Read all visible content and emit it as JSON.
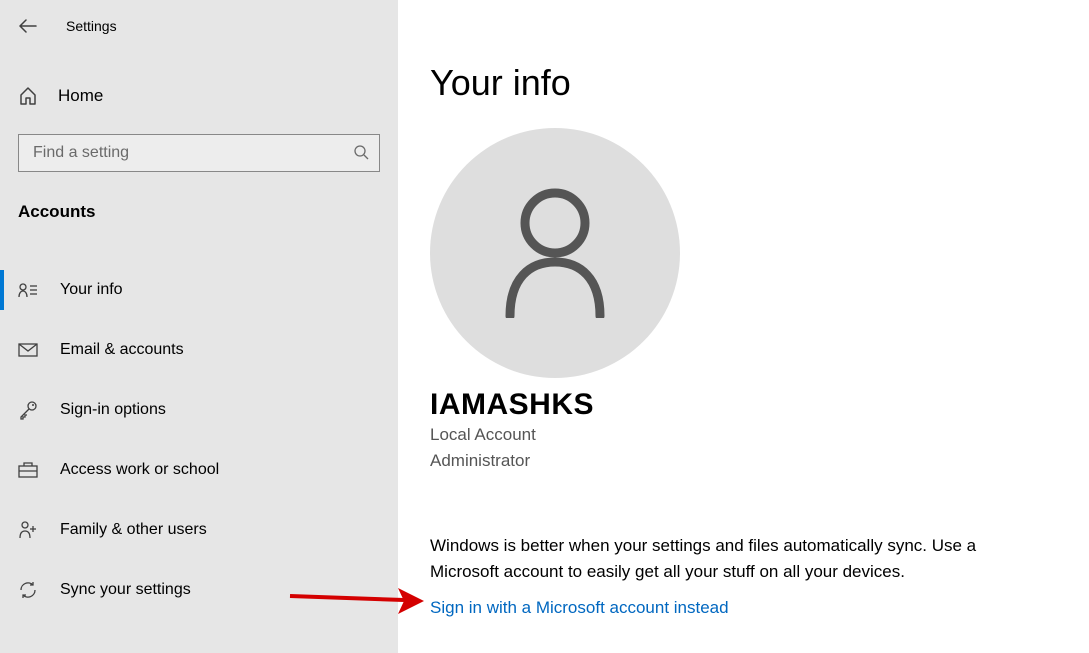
{
  "header": {
    "title": "Settings"
  },
  "sidebar": {
    "home_label": "Home",
    "search_placeholder": "Find a setting",
    "section_title": "Accounts",
    "items": [
      {
        "label": "Your info",
        "icon": "your-info-icon",
        "active": true
      },
      {
        "label": "Email & accounts",
        "icon": "email-icon",
        "active": false
      },
      {
        "label": "Sign-in options",
        "icon": "key-icon",
        "active": false
      },
      {
        "label": "Access work or school",
        "icon": "briefcase-icon",
        "active": false
      },
      {
        "label": "Family & other users",
        "icon": "family-icon",
        "active": false
      },
      {
        "label": "Sync your settings",
        "icon": "sync-icon",
        "active": false
      }
    ]
  },
  "main": {
    "title": "Your info",
    "user_name": "IAMASHKS",
    "account_type": "Local Account",
    "account_role": "Administrator",
    "sync_text": "Windows is better when your settings and files automatically sync. Use a Microsoft account to easily get all your stuff on all your devices.",
    "signin_link": "Sign in with a Microsoft account instead"
  }
}
